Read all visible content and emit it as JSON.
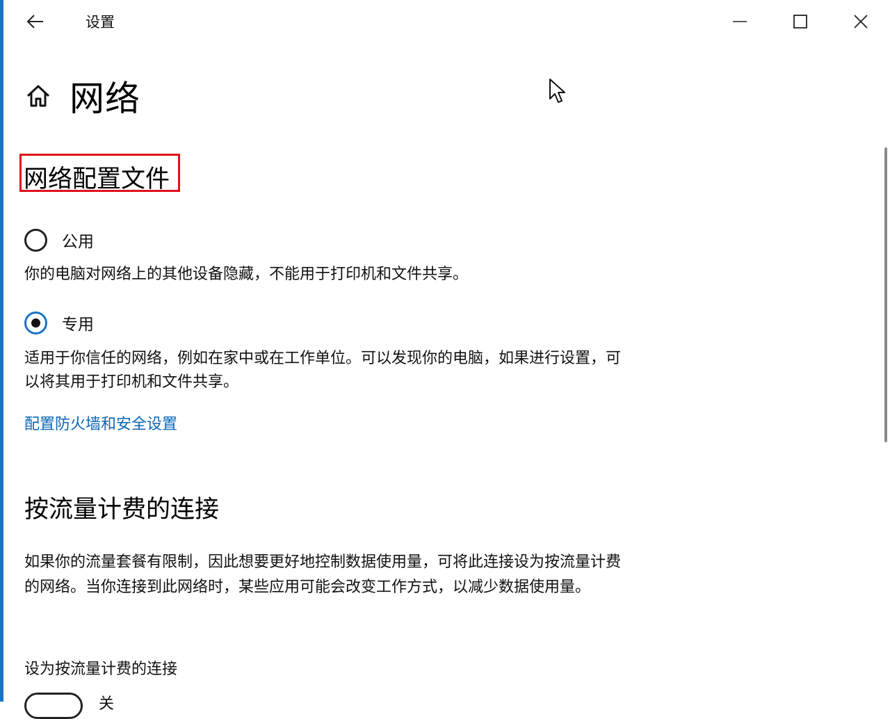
{
  "window": {
    "title": "设置",
    "back_icon": "arrow-left-icon",
    "minimize_icon": "minimize-icon",
    "maximize_icon": "maximize-icon",
    "close_icon": "close-icon"
  },
  "page": {
    "home_icon": "home-icon",
    "title": "网络"
  },
  "network_profile": {
    "heading": "网络配置文件",
    "highlight_color": "#e0101a",
    "options": [
      {
        "label": "公用",
        "selected": false,
        "description": "你的电脑对网络上的其他设备隐藏，不能用于打印机和文件共享。"
      },
      {
        "label": "专用",
        "selected": true,
        "description": "适用于你信任的网络，例如在家中或在工作单位。可以发现你的电脑，如果进行设置，可以将其用于打印机和文件共享。"
      }
    ],
    "firewall_link": "配置防火墙和安全设置"
  },
  "metered": {
    "heading": "按流量计费的连接",
    "description": "如果你的流量套餐有限制，因此想要更好地控制数据使用量，可将此连接设为按流量计费的网络。当你连接到此网络时，某些应用可能会改变工作方式，以减少数据使用量。",
    "toggle_label": "设为按流量计费的连接",
    "toggle_on": false,
    "toggle_state_text": "关"
  },
  "colors": {
    "accent": "#1a73c4",
    "link": "#0a66b7"
  },
  "cursor_icon": "mouse-pointer-icon"
}
